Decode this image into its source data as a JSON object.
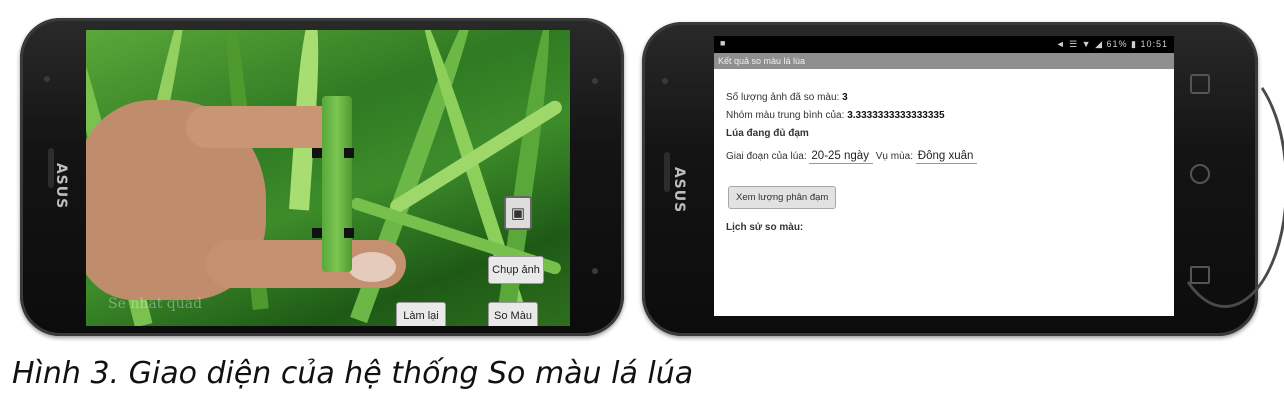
{
  "camera": {
    "watermark": "Se nhat quad",
    "buttons": {
      "capture": "Chụp ảnh",
      "redo": "Làm lại",
      "compare": "So Màu"
    },
    "icons": [
      "camera-icon"
    ]
  },
  "result": {
    "status_left": "■",
    "status_right": "◄ ☰ ▼ ◢ 61% ▮ 10:51",
    "title": "Kết quả so màu lá lúa",
    "count_label": "Số lượng ảnh đã so màu:",
    "count_value": "3",
    "avg_label": "Nhóm màu trung bình của:",
    "avg_value": "3.3333333333333335",
    "status_text": "Lúa đang đủ đạm",
    "stage_label": "Giai đoạn của lúa:",
    "stage_value": "20-25 ngày",
    "season_label": "Vụ mùa:",
    "season_value": "Đông xuân",
    "fertilizer_button": "Xem lượng phân đạm",
    "history_label": "Lịch sử so màu:"
  },
  "brand": "ASUS",
  "caption": "Hình 3. Giao diện của hệ thống So màu lá lúa"
}
